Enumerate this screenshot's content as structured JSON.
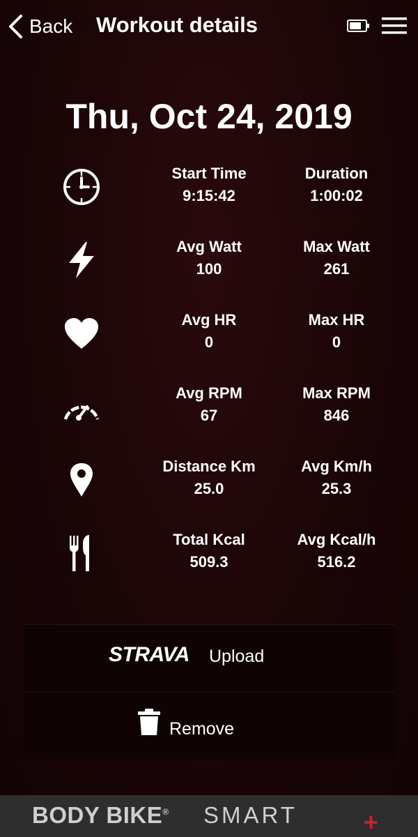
{
  "header": {
    "back_label": "Back",
    "title": "Workout details",
    "battery_icon": "battery-icon",
    "menu_icon": "hamburger-menu-icon"
  },
  "date": "Thu, Oct 24, 2019",
  "stats": [
    {
      "icon": "clock-icon",
      "label1": "Start Time",
      "value1": "9:15:42",
      "label2": "Duration",
      "value2": "1:00:02"
    },
    {
      "icon": "lightning-icon",
      "label1": "Avg Watt",
      "value1": "100",
      "label2": "Max Watt",
      "value2": "261"
    },
    {
      "icon": "heart-icon",
      "label1": "Avg HR",
      "value1": "0",
      "label2": "Max HR",
      "value2": "0"
    },
    {
      "icon": "speedometer-icon",
      "label1": "Avg RPM",
      "value1": "67",
      "label2": "Max RPM",
      "value2": "846"
    },
    {
      "icon": "location-pin-icon",
      "label1": "Distance Km",
      "value1": "25.0",
      "label2": "Avg Km/h",
      "value2": "25.3"
    },
    {
      "icon": "fork-knife-icon",
      "label1": "Total Kcal",
      "value1": "509.3",
      "label2": "Avg Kcal/h",
      "value2": "516.2"
    }
  ],
  "actions": {
    "strava_logo": "STRAVA",
    "upload_label": "Upload",
    "remove_label": "Remove"
  },
  "footer": {
    "brand_body": "BODY BIKE",
    "brand_reg": "®",
    "brand_smart": "SMART",
    "brand_plus": "+"
  },
  "colors": {
    "background": "#1a0506",
    "accent": "#d0202a",
    "footer": "#2e2e2e"
  }
}
